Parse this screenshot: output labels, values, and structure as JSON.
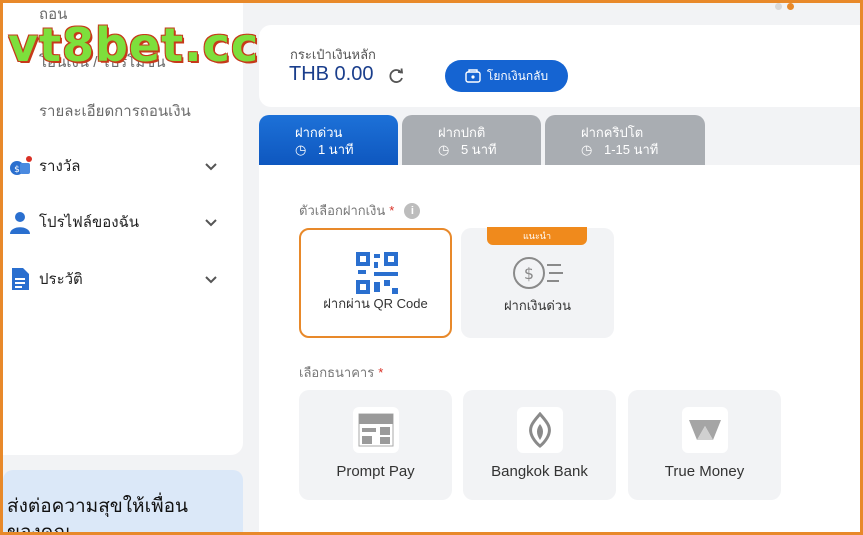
{
  "watermark": "vt8bet.cc",
  "sidebar": {
    "links": [
      "ถอน",
      "โอนเงิน / โปรโมชั่น",
      "รายละเอียดการถอนเงิน"
    ],
    "items": [
      {
        "label": "รางวัล",
        "icon": "reward-icon"
      },
      {
        "label": "โปรไฟล์ของฉัน",
        "icon": "profile-icon"
      },
      {
        "label": "ประวัติ",
        "icon": "history-icon"
      }
    ],
    "promo_line1": "ส่งต่อความสุขให้เพื่อน",
    "promo_line2": "ของคุณ"
  },
  "wallet": {
    "label": "กระเป๋าเงินหลัก",
    "balance": "THB 0.00",
    "transfer_button": "โยกเงินกลับ"
  },
  "tabs": [
    {
      "title": "ฝากด่วน",
      "time": "1 นาที",
      "active": true
    },
    {
      "title": "ฝากปกติ",
      "time": "5 นาที",
      "active": false
    },
    {
      "title": "ฝากคริปโต",
      "time": "1-15 นาที",
      "active": false
    }
  ],
  "deposit_options_label": "ตัวเลือกฝากเงิน",
  "deposit_options": [
    {
      "label": "ฝากผ่าน QR Code",
      "selected": true
    },
    {
      "label": "ฝากเงินด่วน",
      "badge": "แนะนำ",
      "selected": false
    }
  ],
  "bank_label": "เลือกธนาคาร",
  "banks": [
    "Prompt Pay",
    "Bangkok Bank",
    "True Money"
  ],
  "colors": {
    "accent": "#1564d2",
    "highlight": "#e8892a",
    "watermark": "#7ddf3c"
  }
}
